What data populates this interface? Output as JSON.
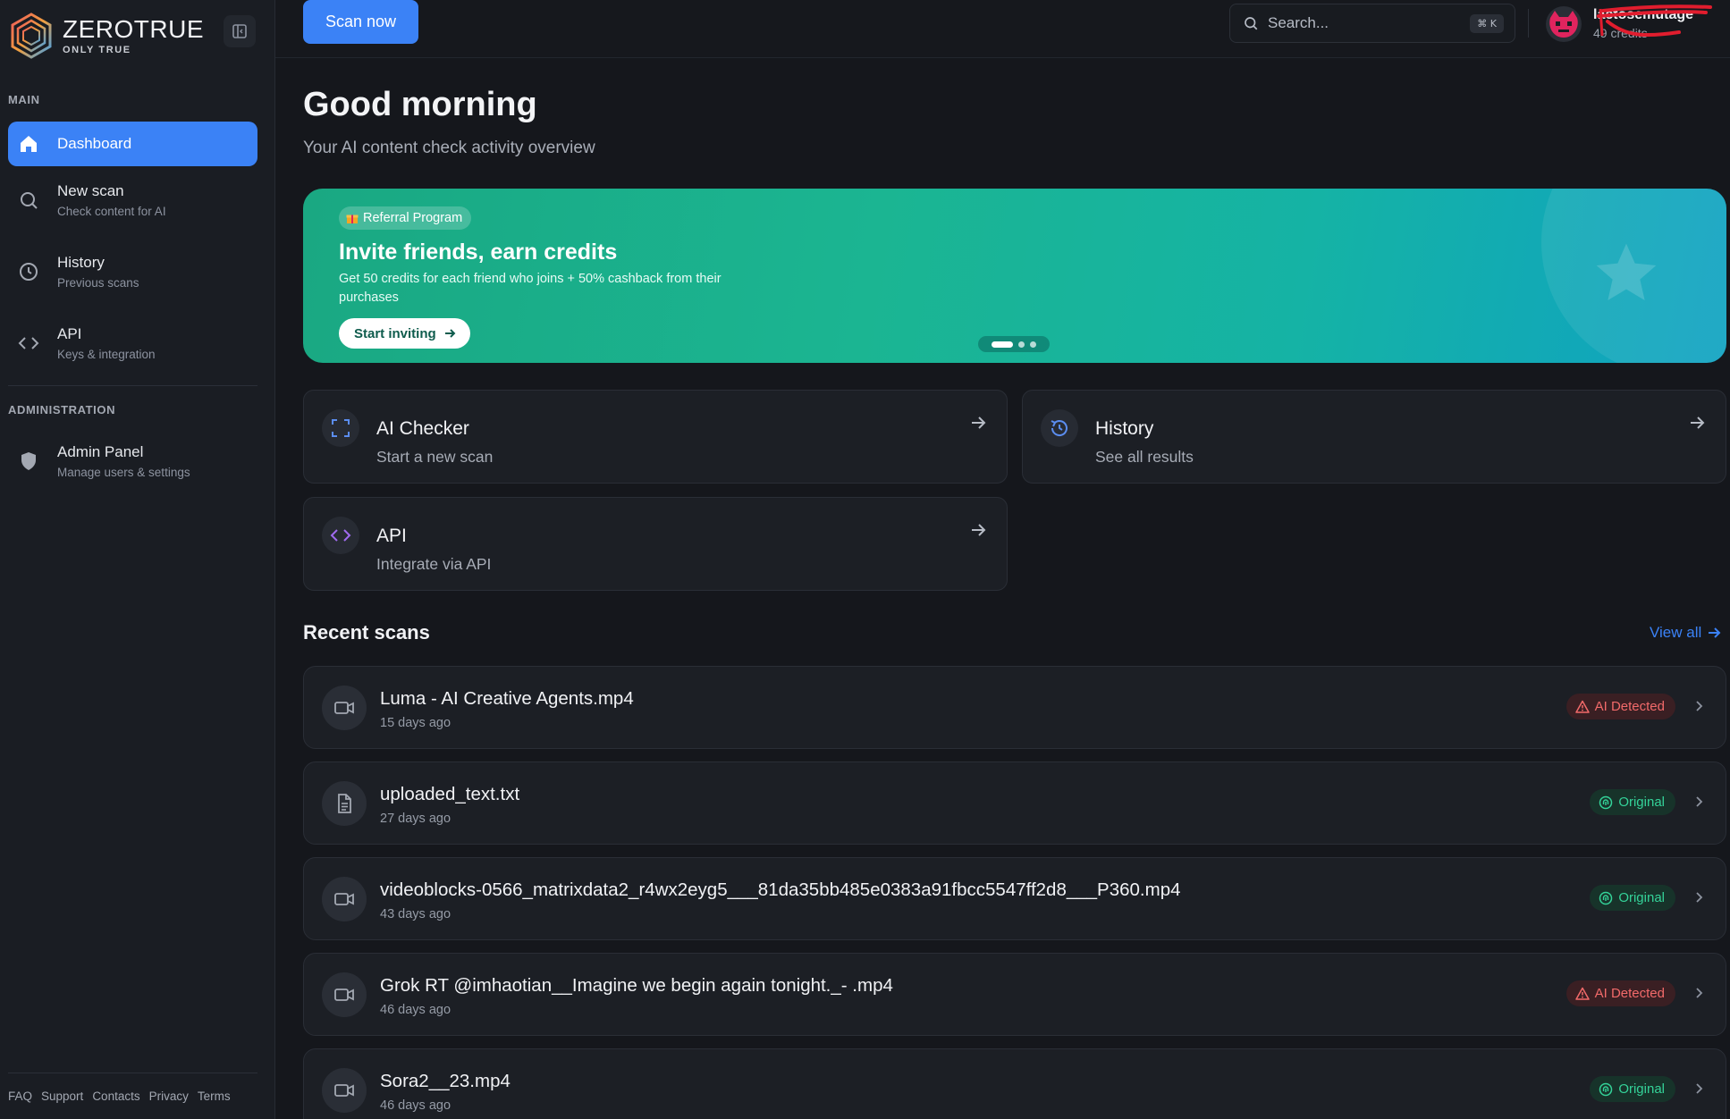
{
  "brand": {
    "name": "ZEROTRUE",
    "tagline": "ONLY TRUE"
  },
  "sidebar": {
    "main_label": "MAIN",
    "admin_label": "ADMINISTRATION",
    "items": [
      {
        "title": "Dashboard",
        "subtitle": ""
      },
      {
        "title": "New scan",
        "subtitle": "Check content for AI"
      },
      {
        "title": "History",
        "subtitle": "Previous scans"
      },
      {
        "title": "API",
        "subtitle": "Keys & integration"
      }
    ],
    "admin_items": [
      {
        "title": "Admin Panel",
        "subtitle": "Manage users & settings"
      }
    ],
    "footer_links": [
      "FAQ",
      "Support",
      "Contacts",
      "Privacy",
      "Terms"
    ]
  },
  "topbar": {
    "scan_button": "Scan now",
    "search_placeholder": "Search...",
    "search_shortcut": "⌘ K",
    "user_name": "lactosemutage",
    "user_credits": "49 credits"
  },
  "header": {
    "greeting": "Good morning",
    "subtitle": "Your AI content check activity overview"
  },
  "banner": {
    "badge": "Referral Program",
    "title": "Invite friends, earn credits",
    "description": "Get 50 credits for each friend who joins + 50% cashback from their purchases",
    "button": "Start inviting",
    "slides": 3,
    "active_slide": 1
  },
  "quick_actions": [
    {
      "title": "AI Checker",
      "subtitle": "Start a new scan",
      "icon": "scan-icon"
    },
    {
      "title": "History",
      "subtitle": "See all results",
      "icon": "history-icon"
    },
    {
      "title": "API",
      "subtitle": "Integrate via API",
      "icon": "code-icon"
    }
  ],
  "recent": {
    "title": "Recent scans",
    "view_all": "View all",
    "scans": [
      {
        "name": "Luma - AI Creative Agents.mp4",
        "when": "15 days ago",
        "status": "AI Detected",
        "type": "video"
      },
      {
        "name": "uploaded_text.txt",
        "when": "27 days ago",
        "status": "Original",
        "type": "text"
      },
      {
        "name": "videoblocks-0566_matrixdata2_r4wx2eyg5___81da35bb485e0383a91fbcc5547ff2d8___P360.mp4",
        "when": "43 days ago",
        "status": "Original",
        "type": "video"
      },
      {
        "name": "Grok RT @imhaotian__Imagine we begin again tonight._- .mp4",
        "when": "46 days ago",
        "status": "AI Detected",
        "type": "video"
      },
      {
        "name": "Sora2__23.mp4",
        "when": "46 days ago",
        "status": "Original",
        "type": "video"
      }
    ]
  },
  "colors": {
    "accent": "#3b82f6",
    "ai_detected": "#f26a6a",
    "original": "#34d399",
    "banner_start": "#1aa882",
    "banner_end": "#0fa2c2"
  }
}
